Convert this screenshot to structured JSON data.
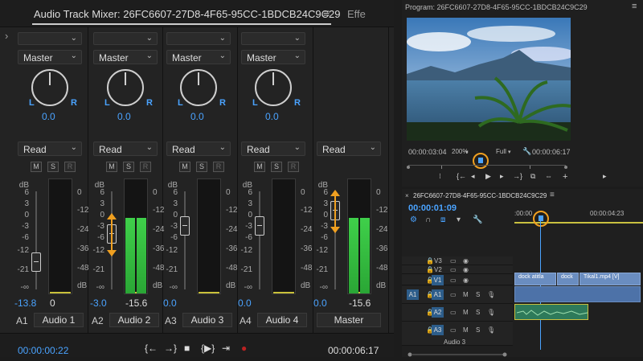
{
  "mixer": {
    "tab_title": "Audio Track Mixer: 26FC6607-27D8-4F65-95CC-1BDCB24C9C29",
    "tab_menu_icon": "≡",
    "next_tab": "Effe",
    "collapse_icon": "›",
    "db_label": "dB",
    "strips": [
      {
        "out": "Master",
        "pan": "0.0",
        "auto": "Read",
        "vol": "-13.8",
        "meter_level": "0",
        "id": "A1",
        "name": "Audio 1",
        "fader_pct": 0.78
      },
      {
        "out": "Master",
        "pan": "0.0",
        "auto": "Read",
        "vol": "-3.0",
        "meter_level": "-15.6",
        "id": "A2",
        "name": "Audio 2",
        "fader_pct": 0.42
      },
      {
        "out": "Master",
        "pan": "0.0",
        "auto": "Read",
        "vol": "0.0",
        "meter_level": "",
        "id": "A3",
        "name": "Audio 3",
        "fader_pct": 0.32
      },
      {
        "out": "Master",
        "pan": "0.0",
        "auto": "Read",
        "vol": "0.0",
        "meter_level": "",
        "id": "A4",
        "name": "Audio 4",
        "fader_pct": 0.32
      },
      {
        "auto": "Read",
        "vol": "0.0",
        "meter_level": "-15.6",
        "name": "Master",
        "fader_pct": 0.12
      }
    ],
    "pan_left": "L",
    "pan_right": "R",
    "btn_m": "M",
    "btn_s": "S",
    "btn_r": "R",
    "left_scale": [
      "6",
      "3",
      "0",
      "-3",
      "-6",
      "-12",
      "-21",
      "-∞"
    ],
    "right_scale": [
      "0",
      "-12",
      "-24",
      "-36",
      "-48",
      "dB"
    ],
    "timecode_left": "00:00:00:22",
    "timecode_right": "00:00:06:17",
    "transport": [
      "{←",
      "→}",
      "■",
      "{▶}",
      "⇥",
      "●"
    ]
  },
  "program": {
    "title": "Program: 26FC6607-27D8-4F65-95CC-1BDCB24C9C29",
    "menu_icon": "≡",
    "timecode": "00:00:03:04",
    "zoom": "200%",
    "quality": "Full",
    "duration": "00:00:06:17"
  },
  "timeline": {
    "title": "26FC6607-27D8-4F65-95CC-1BDCB24C9C29",
    "close_icon": "×",
    "menu_icon": "≡",
    "timecode": "00:00:01:09",
    "ruler": [
      ":00:00",
      "00:00:04:23"
    ],
    "tracks": {
      "video": [
        "V3",
        "V2",
        "V1"
      ],
      "audio": [
        "A1",
        "A2",
        "A3"
      ]
    },
    "audio3_label": "Audio 3",
    "clips": [
      "dock atitla",
      "dock",
      "Tikal1.mp4 [V]"
    ]
  },
  "colors": {
    "accent": "#4aa3ff",
    "highlight": "#f0a020",
    "meter": "#3fd04a"
  }
}
